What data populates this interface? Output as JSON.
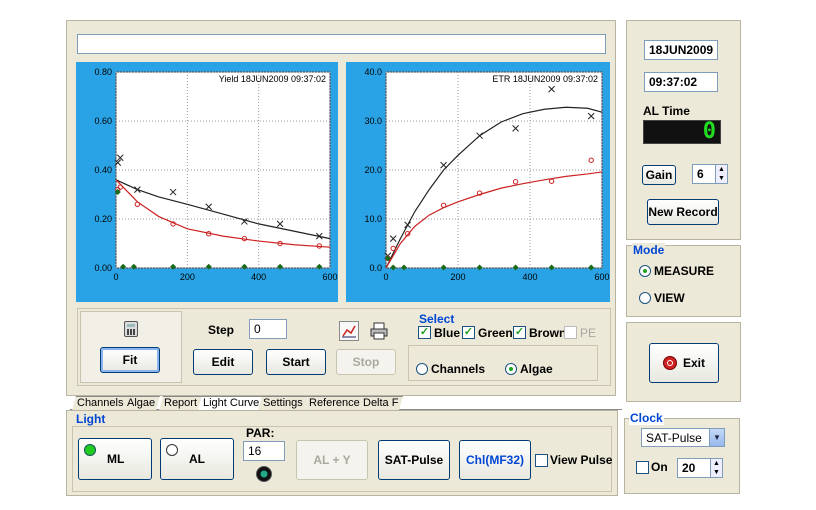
{
  "top_field": {
    "value": ""
  },
  "charts_meta": {
    "yield": {
      "title": "Yield",
      "date": "18JUN2009",
      "time": "09:37:02"
    },
    "etr": {
      "title": "ETR",
      "date": "18JUN2009",
      "time": "09:37:02"
    }
  },
  "chart_data": [
    {
      "type": "scatter",
      "title": "Yield",
      "subtitle": "18JUN2009  09:37:02",
      "xlim": [
        0,
        600
      ],
      "ylim": [
        0,
        0.8
      ],
      "xticks": [
        "0",
        "200",
        "400",
        "600"
      ],
      "yticks": [
        "0.00",
        "0.20",
        "0.40",
        "0.60",
        "0.80"
      ],
      "grid": true,
      "series": [
        {
          "color": "#222222",
          "marker": "x",
          "x": [
            5,
            12,
            60,
            160,
            260,
            360,
            460,
            570
          ],
          "y": [
            0.43,
            0.45,
            0.32,
            0.31,
            0.25,
            0.19,
            0.18,
            0.13
          ]
        },
        {
          "color": "#cc2222",
          "marker": "o",
          "x": [
            5,
            12,
            60,
            160,
            260,
            360,
            460,
            570
          ],
          "y": [
            0.32,
            0.33,
            0.26,
            0.18,
            0.14,
            0.12,
            0.1,
            0.09
          ]
        },
        {
          "color": "#1a6a1a",
          "marker": "diamond",
          "x": [
            5,
            20,
            50,
            160,
            260,
            360,
            460,
            570
          ],
          "y": [
            0.31,
            0.005,
            0.005,
            0.005,
            0.005,
            0.005,
            0.005,
            0.005
          ]
        }
      ],
      "fits": [
        {
          "color": "#222222",
          "x": [
            0,
            60,
            120,
            200,
            300,
            400,
            500,
            600
          ],
          "y": [
            0.36,
            0.32,
            0.29,
            0.26,
            0.22,
            0.18,
            0.15,
            0.12
          ]
        },
        {
          "color": "#cc2222",
          "x": [
            0,
            60,
            120,
            200,
            300,
            400,
            500,
            600
          ],
          "y": [
            0.36,
            0.27,
            0.21,
            0.16,
            0.13,
            0.11,
            0.095,
            0.085
          ]
        }
      ]
    },
    {
      "type": "scatter",
      "title": "ETR",
      "subtitle": "18JUN2009  09:37:02",
      "xlim": [
        0,
        600
      ],
      "ylim": [
        0,
        40
      ],
      "xticks": [
        "0",
        "200",
        "400",
        "600"
      ],
      "yticks": [
        "0.0",
        "10.0",
        "20.0",
        "30.0",
        "40.0"
      ],
      "grid": true,
      "series": [
        {
          "color": "#222222",
          "marker": "x",
          "x": [
            5,
            20,
            60,
            160,
            260,
            360,
            460,
            570
          ],
          "y": [
            2.5,
            6,
            8.8,
            21,
            27,
            28.5,
            36.5,
            31
          ]
        },
        {
          "color": "#cc2222",
          "marker": "o",
          "x": [
            5,
            20,
            60,
            160,
            260,
            360,
            460,
            570
          ],
          "y": [
            2,
            4,
            7,
            12.8,
            15.3,
            17.6,
            17.7,
            22
          ]
        },
        {
          "color": "#1a6a1a",
          "marker": "diamond",
          "x": [
            5,
            20,
            50,
            160,
            260,
            360,
            460,
            570
          ],
          "y": [
            2,
            0.1,
            0.1,
            0.1,
            0.1,
            0.1,
            0.1,
            0.1
          ]
        }
      ],
      "fits": [
        {
          "color": "#222222",
          "x": [
            0,
            40,
            80,
            120,
            160,
            200,
            260,
            320,
            380,
            440,
            500,
            560,
            600
          ],
          "y": [
            0,
            6,
            11.5,
            16,
            20,
            23,
            27,
            29.8,
            31.5,
            32.4,
            32.8,
            32.6,
            31.8
          ]
        },
        {
          "color": "#cc2222",
          "x": [
            0,
            40,
            80,
            120,
            160,
            200,
            260,
            320,
            380,
            440,
            500,
            560,
            600
          ],
          "y": [
            0,
            5,
            8.5,
            10.8,
            12.3,
            13.5,
            15,
            16.3,
            17.2,
            18,
            18.7,
            19.2,
            19.6
          ]
        }
      ]
    }
  ],
  "controls": {
    "fit_label": "Fit",
    "step_label": "Step",
    "step_value": "0",
    "edit_label": "Edit",
    "start_label": "Start",
    "stop_label": "Stop"
  },
  "select": {
    "title": "Select",
    "blue": "Blue",
    "green": "Green",
    "brown": "Brown",
    "pe": "PE",
    "channels": "Channels",
    "algae": "Algae"
  },
  "tabs": [
    "Channels",
    "Algae",
    "Report",
    "Light Curve",
    "Settings",
    "Reference",
    "Delta F"
  ],
  "light": {
    "title": "Light",
    "ml_label": "ML",
    "al_label": "AL",
    "par_label": "PAR:",
    "par_value": "16",
    "al_y_label": "AL + Y",
    "sat_pulse_label": "SAT-Pulse",
    "chl_label": "Chl(MF32)",
    "view_pulse_label": "View Pulse"
  },
  "side": {
    "date": "18JUN2009",
    "time": "09:37:02",
    "al_time_label": "AL Time",
    "al_time_value": "0",
    "gain_label": "Gain",
    "gain_value": "6",
    "new_record_label": "New Record"
  },
  "mode": {
    "title": "Mode",
    "measure": "MEASURE",
    "view": "VIEW"
  },
  "exit_label": "Exit",
  "clock": {
    "title": "Clock",
    "select_value": "SAT-Pulse",
    "on_label": "On",
    "interval_value": "20"
  },
  "colors": {
    "chart_bg": "#2aa3e6",
    "panel_bg": "#ece9d8",
    "title_blue": "#0046d5",
    "lcd_green": "#22dd22"
  }
}
